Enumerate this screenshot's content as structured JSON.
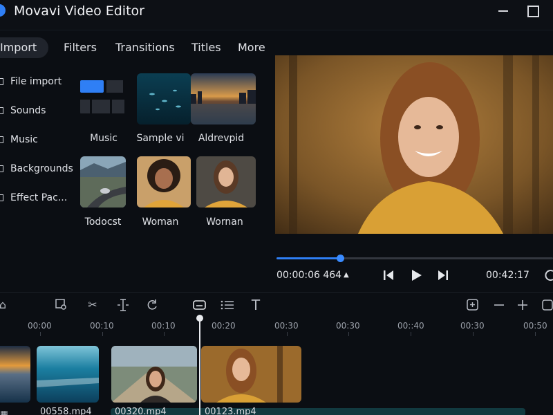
{
  "app": {
    "title": "Movavi Video Editor"
  },
  "tabs": [
    {
      "label": "Import"
    },
    {
      "label": "Filters"
    },
    {
      "label": "Transitions"
    },
    {
      "label": "Titles"
    },
    {
      "label": "More"
    }
  ],
  "sidebar": {
    "items": [
      {
        "label": "File import"
      },
      {
        "label": "Sounds"
      },
      {
        "label": "Music"
      },
      {
        "label": "Backgrounds"
      },
      {
        "label": "Effect Pac..."
      }
    ]
  },
  "media": {
    "items": [
      {
        "label": "Music"
      },
      {
        "label": "Sample vi"
      },
      {
        "label": "Aldrevpid"
      },
      {
        "label": "Todocst"
      },
      {
        "label": "Woman"
      },
      {
        "label": "Wornan"
      }
    ]
  },
  "player": {
    "current_time": "00:00:06 464",
    "total_time": "00:42:17",
    "progress": 0.23
  },
  "ruler": {
    "labels": [
      "00:00",
      "00:10",
      "00:10",
      "00:20",
      "00:30",
      "00:30",
      "00::40",
      "00:30",
      "00:50"
    ]
  },
  "timeline": {
    "clips": [
      {
        "name": ""
      },
      {
        "name": "00558.mp4"
      },
      {
        "name": "00320.mp4"
      },
      {
        "name": "00123.mp4"
      }
    ]
  },
  "colors": {
    "accent": "#2f7ff5",
    "background": "#0b0e13"
  }
}
